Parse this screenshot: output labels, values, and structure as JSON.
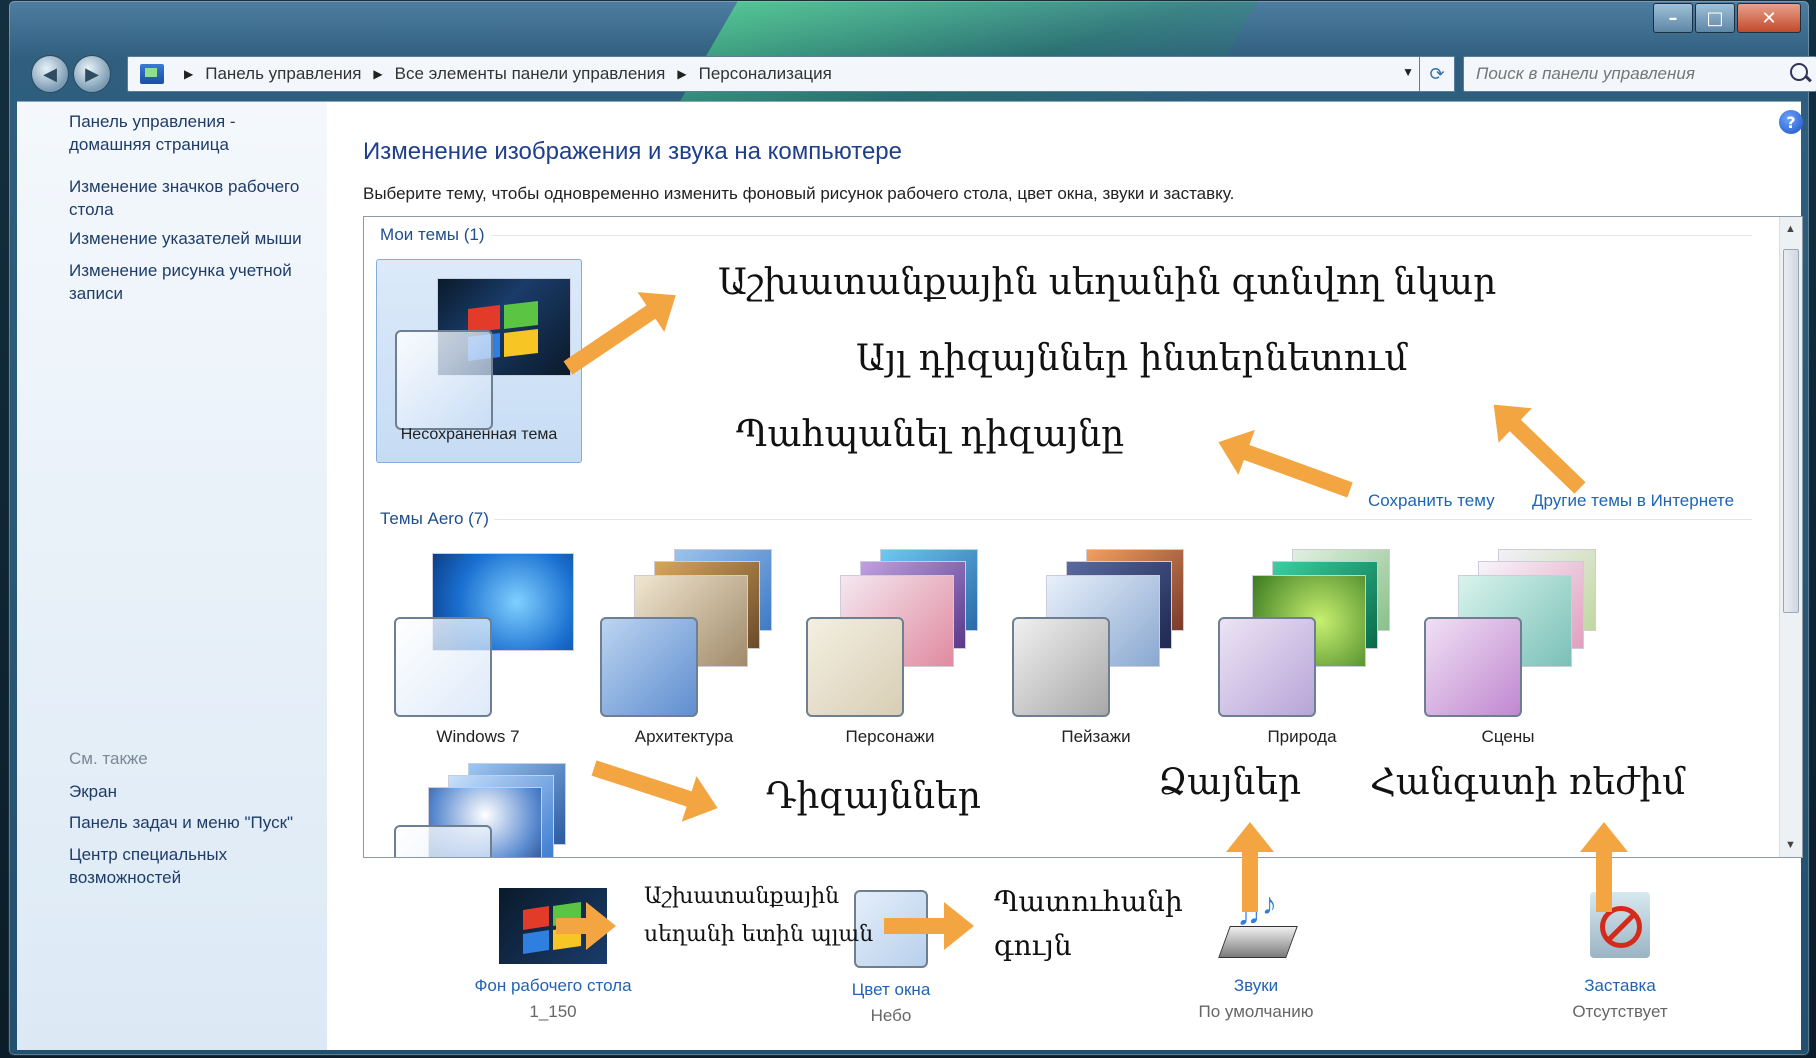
{
  "window": {
    "caption": {
      "minimize": "–",
      "maximize": "□",
      "close": "✕"
    }
  },
  "nav": {
    "back": "◀",
    "forward": "▶",
    "breadcrumbs": [
      "Панель управления",
      "Все элементы панели управления",
      "Персонализация"
    ],
    "search_placeholder": "Поиск в панели управления",
    "refresh": "⟳"
  },
  "sidebar": {
    "home_link": "Панель управления - домашняя страница",
    "links": [
      "Изменение значков рабочего стола",
      "Изменение указателей мыши",
      "Изменение рисунка учетной записи"
    ],
    "see_also_label": "См. также",
    "see_also": [
      "Экран",
      "Панель задач и меню \"Пуск\"",
      "Центр специальных возможностей"
    ]
  },
  "main": {
    "title": "Изменение изображения и звука на компьютере",
    "description": "Выберите тему, чтобы одновременно изменить фоновый рисунок рабочего стола, цвет окна, звуки и заставку.",
    "my_themes_heading": "Мои темы (1)",
    "unsaved_theme": "Несохраненная тема",
    "save_theme_link": "Сохранить тему",
    "more_themes_link": "Другие темы в Интернете",
    "aero_heading": "Темы Aero (7)",
    "aero_themes": [
      "Windows 7",
      "Архитектура",
      "Персонажи",
      "Пейзажи",
      "Природа",
      "Сцены"
    ]
  },
  "bottom": {
    "desktop_bg": {
      "label": "Фон рабочего стола",
      "value": "1_150"
    },
    "window_color": {
      "label": "Цвет окна",
      "value": "Небо"
    },
    "sounds": {
      "label": "Звуки",
      "value": "По умолчанию"
    },
    "screensaver": {
      "label": "Заставка",
      "value": "Отсутствует"
    }
  },
  "annotations": {
    "desktop_image": "Աշխատանքային սեղանին գտնվող նկար",
    "more_online": "Այլ դիզայններ ինտերնետում",
    "save_design": "Պահպանել դիզայնը",
    "designs": "Դիզայններ",
    "sounds": "Ձայներ",
    "screensaver": "Հանգստի ռեժիմ",
    "bg_line1": "Աշխատանքային",
    "bg_line2": "սեղանի ետին պլան",
    "color_line1": "Պատուհանի",
    "color_line2": "գույն"
  },
  "colors": {
    "link": "#1f64b3",
    "title": "#1e3f8a",
    "arrow": "#f3a541"
  }
}
